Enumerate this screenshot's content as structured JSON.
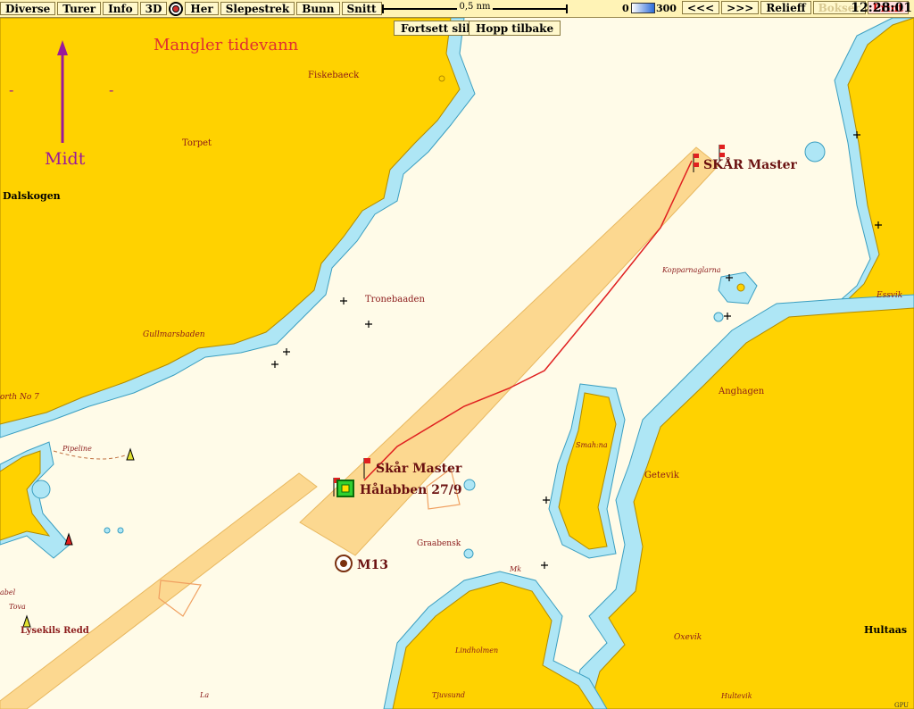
{
  "toolbar": {
    "items": [
      "Diverse",
      "Turer",
      "Info",
      "3D"
    ],
    "items2": [
      "Her",
      "Slepestrek",
      "Bunn",
      "Snitt"
    ],
    "scale_label": "0,5 nm",
    "depth_min": "0",
    "depth_max": "300",
    "prev": "<<<",
    "next": ">>>",
    "relief": "Relieff",
    "bokser": "Bokser",
    "print": "Print",
    "clock": "12:28:01"
  },
  "actions": {
    "continue": "Fortsett slik",
    "jump_back": "Hopp tilbake"
  },
  "overlay": {
    "tide_warning": "Mangler tidevann",
    "north_label": "Midt",
    "dash_left": "-",
    "dash_right": "-"
  },
  "waypoints": {
    "skar_master_top": "SKÅR Master",
    "skar_master_mid": "Skår Master",
    "halabben": "Hålabben 27/9",
    "m13": "M13",
    "lysekils_redd": "Lysekils Redd"
  },
  "place_names": {
    "fiskebaeck": "Fiskebaeck",
    "torpet": "Torpet",
    "dalskogen": "Dalskogen",
    "tronebaaden": "Tronebaaden",
    "gullmarsbaden": "Gullmarsbaden",
    "north7": "orth No 7",
    "pipeline": "Pipeline",
    "kopparnaglarna": "Kopparnaglarna",
    "essvik": "Essvik",
    "anghagen": "Anghagen",
    "smahna": "Smah:na",
    "getevik": "Getevik",
    "graabensk": "Graabensk",
    "mk": "Mk",
    "lindholmen": "Lindholmen",
    "oxevik": "Oxevik",
    "hultaas": "Hultaas",
    "hultevik": "Hultevik",
    "tjuvsund": "Tjuvsund",
    "la": "La",
    "tova": "Tova",
    "abel": "abel",
    "gpu": "GPU"
  },
  "colors": {
    "land": "#ffd200",
    "shallow": "#aee6f5",
    "sea": "#fffbe8",
    "fairway": "#fcd890",
    "route": "#e02020",
    "label": "#8b1a1a"
  }
}
